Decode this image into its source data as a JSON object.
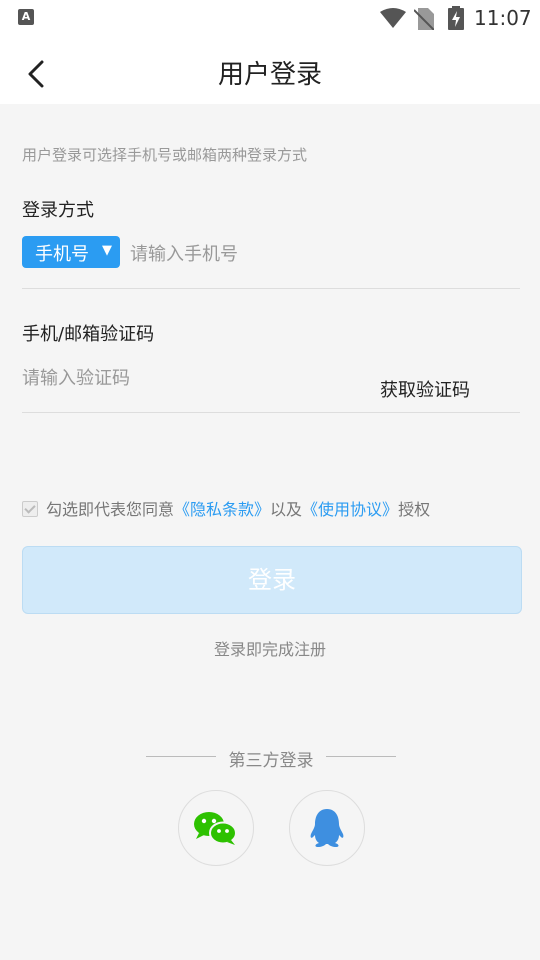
{
  "status_bar": {
    "time": "11:07",
    "app_icon_letter": "A"
  },
  "header": {
    "title": "用户登录"
  },
  "hint": "用户登录可选择手机号或邮箱两种登录方式",
  "login_method": {
    "label": "登录方式",
    "type_selected": "手机号",
    "phone_placeholder": "请输入手机号"
  },
  "verification": {
    "label": "手机/邮箱验证码",
    "code_placeholder": "请输入验证码",
    "get_code_label": "获取验证码"
  },
  "agreement": {
    "prefix": "勾选即代表您同意",
    "privacy_link": "《隐私条款》",
    "middle": "以及",
    "terms_link": "《使用协议》",
    "suffix": "授权"
  },
  "login_button": "登录",
  "register_note": "登录即完成注册",
  "third_party": {
    "title": "第三方登录",
    "wechat_color": "#2dc100",
    "qq_color": "#3e8fe0"
  },
  "accent_color": "#2b9cf2"
}
